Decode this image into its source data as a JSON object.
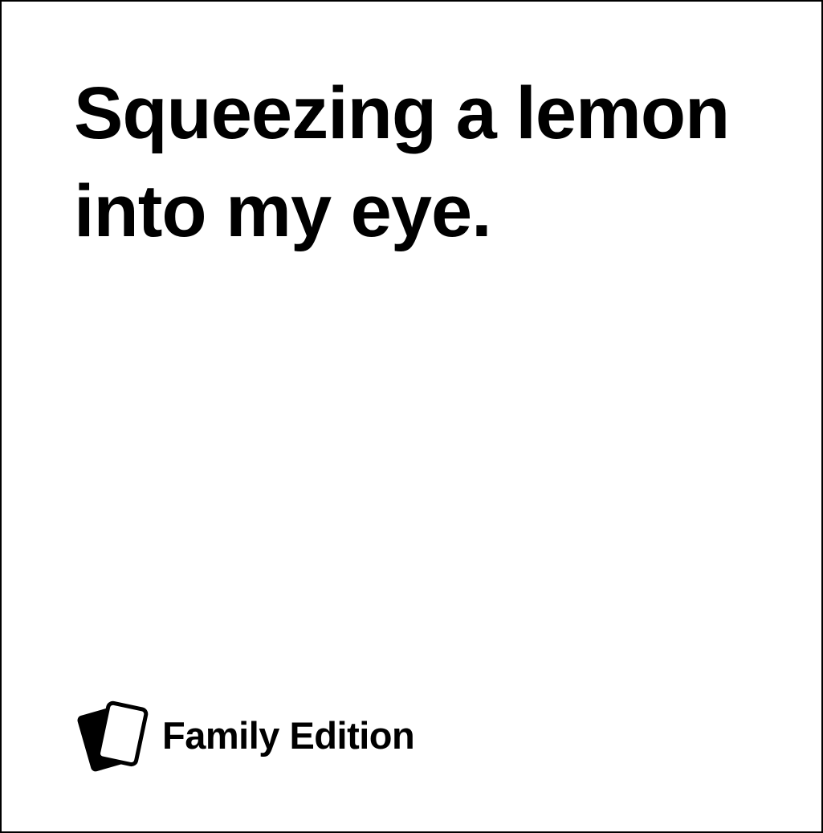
{
  "card": {
    "text": "Squeezing a lemon into my eye.",
    "edition_label": "Family Edition",
    "logo_icon": "stacked-cards-icon"
  },
  "colors": {
    "background": "#ffffff",
    "text": "#000000",
    "border": "#000000"
  }
}
